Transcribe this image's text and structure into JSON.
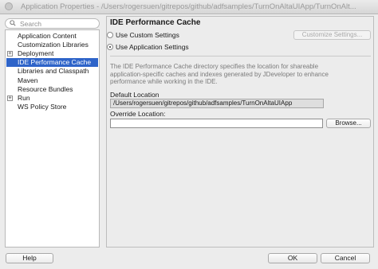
{
  "window": {
    "title": "Application Properties - /Users/rogersuen/gitrepos/github/adfsamples/TurnOnAltaUIApp/TurnOnAlt..."
  },
  "search": {
    "placeholder": "Search",
    "value": ""
  },
  "nav": {
    "items": [
      {
        "label": "Application Content",
        "expandable": false,
        "selected": false
      },
      {
        "label": "Customization Libraries",
        "expandable": false,
        "selected": false
      },
      {
        "label": "Deployment",
        "expandable": true,
        "selected": false
      },
      {
        "label": "IDE Performance Cache",
        "expandable": false,
        "selected": true
      },
      {
        "label": "Libraries and Classpath",
        "expandable": false,
        "selected": false
      },
      {
        "label": "Maven",
        "expandable": false,
        "selected": false
      },
      {
        "label": "Resource Bundles",
        "expandable": false,
        "selected": false
      },
      {
        "label": "Run",
        "expandable": true,
        "selected": false
      },
      {
        "label": "WS Policy Store",
        "expandable": false,
        "selected": false
      }
    ],
    "expander_glyph": "+"
  },
  "panel": {
    "title": "IDE Performance Cache",
    "use_custom_label": "Use Custom Settings",
    "use_app_label": "Use Application Settings",
    "selected_option": "application",
    "customize_button": "Customize Settings...",
    "description": "The IDE Performance Cache directory specifies the location for shareable application-specific caches and indexes generated by JDeveloper to enhance performance while working in the IDE.",
    "default_location_label": "Default Location",
    "default_location_value": "/Users/rogersuen/gitrepos/github/adfsamples/TurnOnAltaUIApp",
    "override_location_label": "Override Location:",
    "override_location_value": "",
    "browse_button": "Browse..."
  },
  "footer": {
    "help": "Help",
    "ok": "OK",
    "cancel": "Cancel"
  }
}
